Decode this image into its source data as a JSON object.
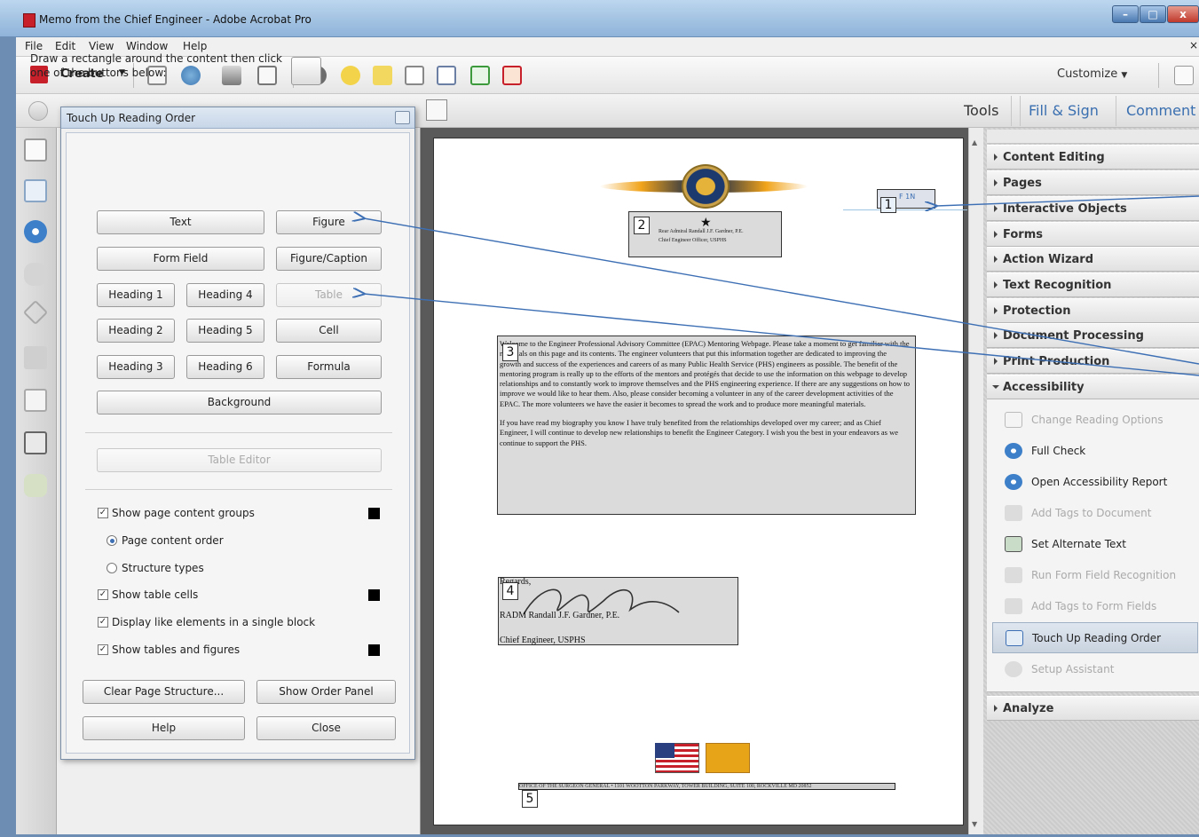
{
  "window": {
    "title": "Memo from the Chief Engineer - Adobe Acrobat Pro",
    "controls": {
      "minimize": "–",
      "maximize": "□",
      "close": "x"
    }
  },
  "menubar": {
    "items": [
      "File",
      "Edit",
      "View",
      "Window",
      "Help"
    ],
    "close_glyph": "×"
  },
  "toolbar": {
    "create_label": "Create",
    "customize_label": "Customize",
    "icons": [
      "save-icon",
      "cloud-upload-icon",
      "print-icon",
      "email-icon",
      "settings-icon",
      "comment-icon",
      "sticky-note-icon",
      "document-icon",
      "document-search-icon",
      "export-icon",
      "form-icon"
    ]
  },
  "panel_tabs": {
    "tools": "Tools",
    "fill_sign": "Fill & Sign",
    "comment": "Comment"
  },
  "right_pane": {
    "sections": [
      "Content Editing",
      "Pages",
      "Interactive Objects",
      "Forms",
      "Action Wizard",
      "Text Recognition",
      "Protection",
      "Document Processing",
      "Print Production",
      "Accessibility"
    ],
    "accessibility_items": [
      {
        "label": "Change Reading Options",
        "enabled": false
      },
      {
        "label": "Full Check",
        "enabled": true
      },
      {
        "label": "Open Accessibility Report",
        "enabled": true
      },
      {
        "label": "Add Tags to Document",
        "enabled": false
      },
      {
        "label": "Set Alternate Text",
        "enabled": true
      },
      {
        "label": "Run Form Field Recognition",
        "enabled": false
      },
      {
        "label": "Add Tags to Form Fields",
        "enabled": false
      },
      {
        "label": "Touch Up Reading Order",
        "enabled": true,
        "selected": true
      },
      {
        "label": "Setup Assistant",
        "enabled": false
      }
    ],
    "analyze": "Analyze"
  },
  "dialog": {
    "title": "Touch Up Reading Order",
    "instructions": "Draw a rectangle around the content then click one of the buttons below:",
    "buttons": {
      "text": "Text",
      "figure": "Figure",
      "form_field": "Form Field",
      "figure_caption": "Figure/Caption",
      "heading1": "Heading 1",
      "heading4": "Heading 4",
      "table": "Table",
      "heading2": "Heading 2",
      "heading5": "Heading 5",
      "cell": "Cell",
      "heading3": "Heading 3",
      "heading6": "Heading 6",
      "formula": "Formula",
      "background": "Background",
      "table_editor": "Table Editor",
      "clear_page_structure": "Clear Page Structure...",
      "show_order_panel": "Show Order Panel",
      "help": "Help",
      "close": "Close"
    },
    "options": {
      "show_page_content_groups": "Show page content groups",
      "page_content_order": "Page content order",
      "structure_types": "Structure types",
      "show_table_cells": "Show table cells",
      "display_like_elements": "Display like elements in a single block",
      "show_tables_figures": "Show tables and figures"
    },
    "check_glyph": "✓"
  },
  "document": {
    "tag_numbers": [
      "1",
      "2",
      "3",
      "4",
      "5"
    ],
    "header_name": "Rear Admiral Randall J.F. Gardner, P.E.",
    "header_title": "Chief Engineer Officer, USPHS",
    "ref_text": "F 1N",
    "body_para1": "Welcome to the Engineer Professional Advisory Committee (EPAC) Mentoring Webpage. Please take a moment to get familiar with the materials on this page and its contents. The engineer volunteers that put this information together are dedicated to improving the growth and success of the experiences and careers of as many Public Health Service (PHS) engineers as possible. The benefit of the mentoring program is really up to the efforts of the mentors and protégés that decide to use the information on this webpage to develop relationships and to constantly work to improve themselves and the PHS engineering experience. If there are any suggestions on how to improve we would like to hear them. Also, please consider becoming a volunteer in any of the career development activities of the EPAC. The more volunteers we have the easier it becomes to spread the work and to produce more meaningful materials.",
    "body_para2": "If you have read my biography you know I have truly benefited from the relationships developed over my career; and as Chief Engineer, I will continue to develop new relationships to benefit the Engineer Category. I wish you the best in your endeavors as we continue to support the PHS.",
    "sig_closing": "Regards,",
    "sig_name": "RADM Randall J.F. Gardner, P.E.",
    "sig_title": "Chief Engineer, USPHS",
    "footer": "OFFICE OF THE SURGEON GENERAL • 1101 WOOTTON PARKWAY, TOWER BUILDING, SUITE 100, ROCKVILLE MD 20852"
  },
  "colors": {
    "accent": "#3a6fb0",
    "arrow": "#3d6fb4",
    "tag_fill": "#c0c0c0"
  }
}
